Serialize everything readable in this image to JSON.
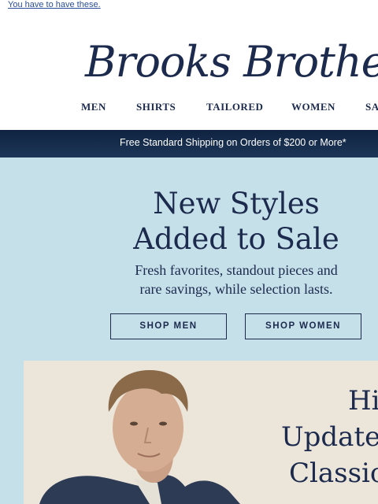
{
  "preheader": {
    "text": "You have to have these."
  },
  "brand": {
    "logo_text": "Brooks Brothers"
  },
  "nav": {
    "items": [
      {
        "label": "MEN"
      },
      {
        "label": "SHIRTS"
      },
      {
        "label": "TAILORED"
      },
      {
        "label": "WOMEN"
      },
      {
        "label": "SA"
      }
    ]
  },
  "shipping_bar": {
    "text": "Free Standard Shipping on Orders of $200 or More*"
  },
  "hero": {
    "headline_line1": "New Styles",
    "headline_line2": "Added to Sale",
    "subhead_line1": "Fresh favorites, standout pieces and",
    "subhead_line2": "rare savings, while selection lasts.",
    "shop_men_label": "SHOP MEN",
    "shop_women_label": "SHOP WOMEN"
  },
  "feature": {
    "line1": "Hi",
    "line2": "Updated",
    "line3": "Classic"
  },
  "colors": {
    "navy": "#1b2a4d",
    "hero_bg": "#c6e0ea",
    "photo_bg": "#ede7dc"
  }
}
